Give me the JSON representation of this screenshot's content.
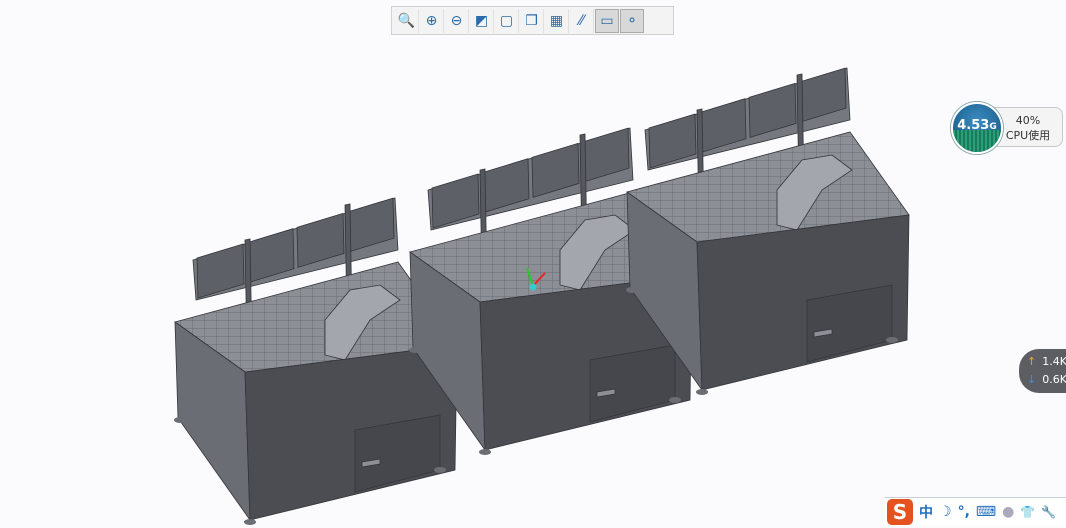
{
  "toolbar": {
    "buttons": [
      {
        "name": "refit-icon",
        "label": "Refit"
      },
      {
        "name": "zoom-in-icon",
        "label": "Zoom In"
      },
      {
        "name": "zoom-out-icon",
        "label": "Zoom Out"
      },
      {
        "name": "repaint-icon",
        "label": "Repaint"
      },
      {
        "name": "display-style-icon",
        "label": "Display Style"
      },
      {
        "name": "saved-orientations-icon",
        "label": "Saved Orientations"
      },
      {
        "name": "view-manager-icon",
        "label": "View Manager"
      },
      {
        "name": "datum-display-icon",
        "label": "Datum Display Filters"
      },
      {
        "name": "annotation-display-icon",
        "label": "Annotation Display",
        "active": true
      },
      {
        "name": "spin-center-icon",
        "label": "Spin Center",
        "active": true
      }
    ]
  },
  "cpu_widget": {
    "memory_value": "4.53",
    "memory_unit": "G",
    "cpu_percent": "40%",
    "cpu_label": "CPU使用"
  },
  "net_widget": {
    "upload": "1.4K",
    "download": "0.6K",
    "up_color": "#f0a030",
    "down_color": "#3a8fe0"
  },
  "ime_bar": {
    "logo": "S",
    "mode": "中",
    "moon": "☽",
    "punct": "°,",
    "keyboard": "⌨",
    "shirt": "👕",
    "wrench": "🔧"
  },
  "colors": {
    "background": "#fbfbfd",
    "model_dark": "#4b4d53",
    "model_light": "#8b8e95"
  }
}
